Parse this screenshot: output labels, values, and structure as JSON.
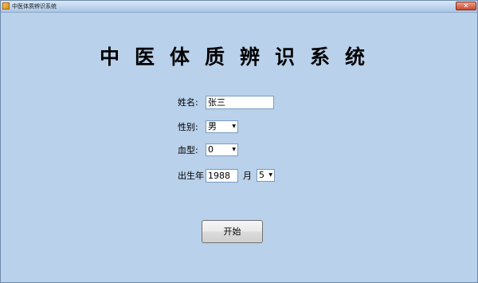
{
  "window": {
    "title": "中医体质辨识系统",
    "close_glyph": "✕"
  },
  "main": {
    "app_title": "中医体质辨识系统"
  },
  "form": {
    "name_label": "姓名:",
    "name_value": "张三",
    "gender_label": "性别:",
    "gender_value": "男",
    "blood_label": "血型:",
    "blood_value": "0",
    "birth_year_label": "出生年",
    "birth_year_value": "1988",
    "month_label": "月",
    "month_value": "5",
    "dropdown_glyph": "▼"
  },
  "actions": {
    "start_label": "开始"
  }
}
